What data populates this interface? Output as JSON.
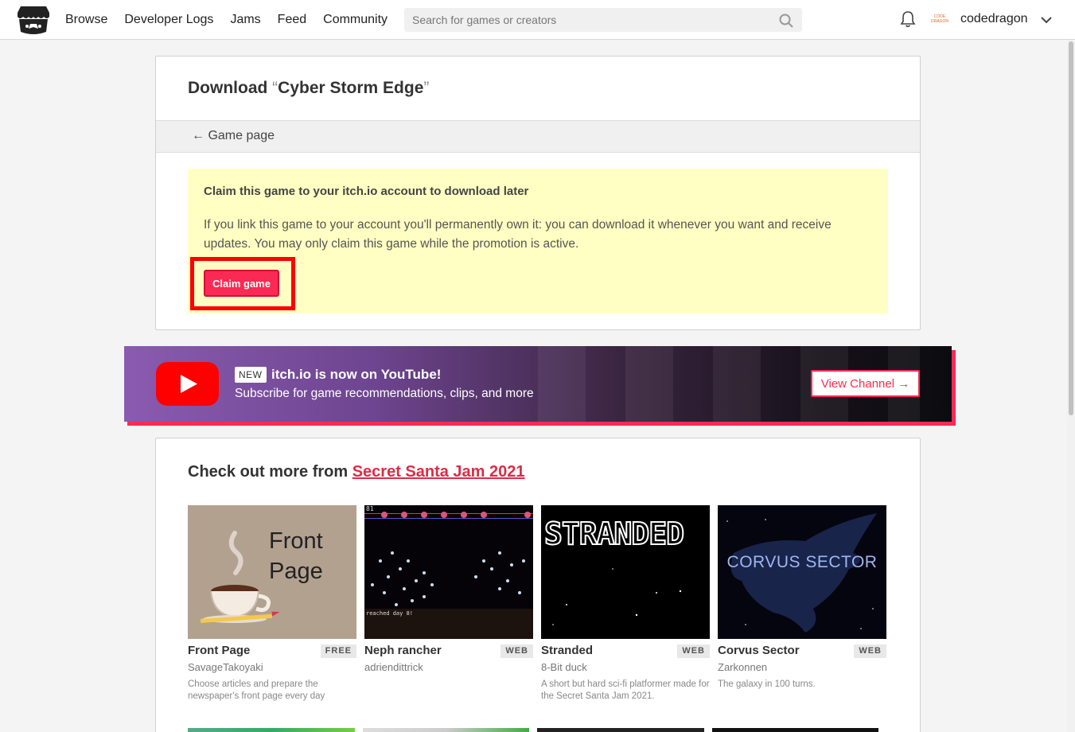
{
  "header": {
    "nav": [
      "Browse",
      "Developer Logs",
      "Jams",
      "Feed",
      "Community"
    ],
    "search_placeholder": "Search for games or creators",
    "avatar_text": "CODE DRAGON",
    "username": "codedragon"
  },
  "download": {
    "title_prefix": "Download ",
    "quote_open": "“",
    "game_name": "Cyber Storm Edge",
    "quote_close": "”",
    "back_label": "← Game page",
    "claim_heading": "Claim this game to your itch.io account to download later",
    "claim_text": "If you link this game to your account you'll permanently own it: you can download it whenever you want and receive updates. You may only claim this game while the promotion is active.",
    "claim_button": "Claim game"
  },
  "youtube_banner": {
    "badge": "NEW",
    "title": "itch.io is now on YouTube!",
    "subtitle": "Subscribe for game recommendations, clips, and more",
    "button": "View Channel →"
  },
  "more": {
    "prefix": "Check out more from ",
    "jam_name": "Secret Santa Jam 2021",
    "games": [
      {
        "title": "Front Page",
        "badge": "FREE",
        "author": "SavageTakoyaki",
        "desc": "Choose articles and prepare the newspaper's front page every day",
        "thumb_text_1": "Front",
        "thumb_text_2": "Page"
      },
      {
        "title": "Neph rancher",
        "badge": "WEB",
        "author": "adriendittrick",
        "desc": "",
        "thumb_text_1": "81",
        "thumb_text_2": "reached day 8!"
      },
      {
        "title": "Stranded",
        "badge": "WEB",
        "author": "8-Bit duck",
        "desc": "A short but hard sci-fi platformer made for the Secret Santa Jam 2021.",
        "thumb_text_1": "STRANDED",
        "thumb_text_2": ""
      },
      {
        "title": "Corvus Sector",
        "badge": "WEB",
        "author": "Zarkonnen",
        "desc": "The galaxy in 100 turns.",
        "thumb_text_1": "CORVUS SECTOR",
        "thumb_text_2": ""
      }
    ]
  },
  "colors": {
    "accent": "#fa2a54",
    "claim_bg": "#ffffc3",
    "link": "#da2c49"
  }
}
